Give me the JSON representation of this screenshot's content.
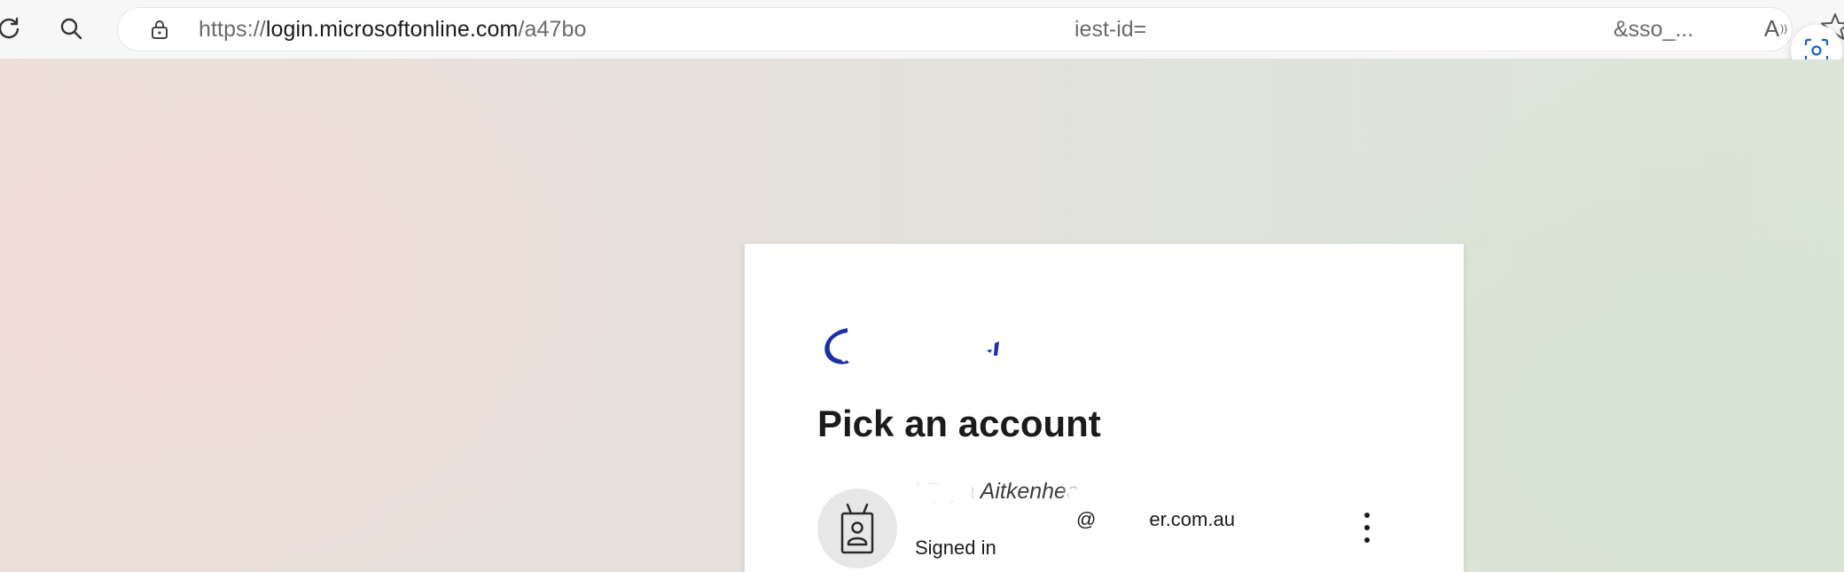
{
  "browser": {
    "url_scheme": "https://",
    "url_host": "login.microsoftonline.com",
    "url_path": "/a47bo",
    "url_mid": "iest-id=",
    "url_tail": "&sso_...",
    "read_aloud_label": "A",
    "read_aloud_sub": "))"
  },
  "card": {
    "title": "Pick an account",
    "account": {
      "name": "Vijaya Aitkenhea",
      "email": "@",
      "email_domain": "er.com.au",
      "status": "Signed in"
    }
  },
  "colors": {
    "logo_blue": "#1b2fa6",
    "card_bg": "#ffffff",
    "avatar_bg": "#e7e7e7"
  }
}
